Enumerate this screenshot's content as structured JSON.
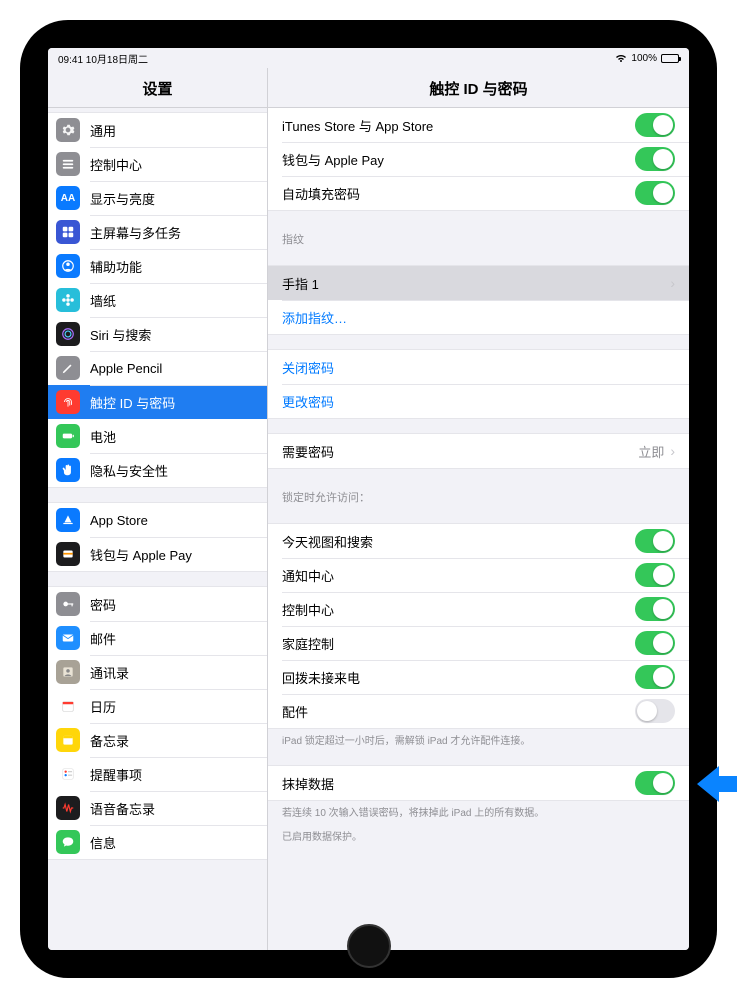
{
  "status": {
    "time_date": "09:41 10月18日周二",
    "battery_pct": "100%"
  },
  "sidebar": {
    "title": "设置",
    "groups": [
      {
        "items": [
          {
            "id": "general",
            "label": "通用",
            "icon_bg": "#8e8e93",
            "icon": "gear"
          },
          {
            "id": "control-center",
            "label": "控制中心",
            "icon_bg": "#8e8e93",
            "icon": "sliders"
          },
          {
            "id": "display-brightness",
            "label": "显示与亮度",
            "icon_bg": "#0a7aff",
            "icon": "aa"
          },
          {
            "id": "home-screen",
            "label": "主屏幕与多任务",
            "icon_bg": "#3956d4",
            "icon": "grid"
          },
          {
            "id": "accessibility",
            "label": "辅助功能",
            "icon_bg": "#0a7aff",
            "icon": "person"
          },
          {
            "id": "wallpaper",
            "label": "墙纸",
            "icon_bg": "#27beda",
            "icon": "flower"
          },
          {
            "id": "siri-search",
            "label": "Siri 与搜索",
            "icon_bg": "#1c1c1e",
            "icon": "siri"
          },
          {
            "id": "apple-pencil",
            "label": "Apple Pencil",
            "icon_bg": "#8e8e93",
            "icon": "pencil"
          },
          {
            "id": "touchid-passcode",
            "label": "触控 ID 与密码",
            "icon_bg": "#ff3b30",
            "icon": "fingerprint",
            "selected": true
          },
          {
            "id": "battery",
            "label": "电池",
            "icon_bg": "#34c759",
            "icon": "battery"
          },
          {
            "id": "privacy-security",
            "label": "隐私与安全性",
            "icon_bg": "#0a7aff",
            "icon": "hand"
          }
        ]
      },
      {
        "items": [
          {
            "id": "app-store",
            "label": "App Store",
            "icon_bg": "#0a7aff",
            "icon": "appstore"
          },
          {
            "id": "wallet-applepay",
            "label": "钱包与 Apple Pay",
            "icon_bg": "#1c1c1e",
            "icon": "wallet"
          }
        ]
      },
      {
        "items": [
          {
            "id": "passwords",
            "label": "密码",
            "icon_bg": "#8e8e93",
            "icon": "key"
          },
          {
            "id": "mail",
            "label": "邮件",
            "icon_bg": "#1f8fff",
            "icon": "mail"
          },
          {
            "id": "contacts",
            "label": "通讯录",
            "icon_bg": "#a8a296",
            "icon": "contacts"
          },
          {
            "id": "calendar",
            "label": "日历",
            "icon_bg": "#ffffff",
            "icon": "calendar"
          },
          {
            "id": "notes",
            "label": "备忘录",
            "icon_bg": "#ffd60a",
            "icon": "notes"
          },
          {
            "id": "reminders",
            "label": "提醒事项",
            "icon_bg": "#ffffff",
            "icon": "reminders"
          },
          {
            "id": "voice-memos",
            "label": "语音备忘录",
            "icon_bg": "#1c1c1e",
            "icon": "voice"
          },
          {
            "id": "messages",
            "label": "信息",
            "icon_bg": "#34c759",
            "icon": "message"
          }
        ]
      }
    ]
  },
  "detail": {
    "title": "触控 ID 与密码",
    "use_for": {
      "itunes_appstore": {
        "label": "iTunes Store 与 App Store",
        "on": true
      },
      "wallet_applepay": {
        "label": "钱包与 Apple Pay",
        "on": true
      },
      "password_autofill": {
        "label": "自动填充密码",
        "on": true
      }
    },
    "fingerprints": {
      "header": "指纹",
      "finger1": "手指 1",
      "add": "添加指纹…"
    },
    "passcode": {
      "turn_off": "关闭密码",
      "change": "更改密码"
    },
    "require": {
      "label": "需要密码",
      "value": "立即"
    },
    "allow_access": {
      "header": "锁定时允许访问：",
      "today_search": {
        "label": "今天视图和搜索",
        "on": true
      },
      "notification_center": {
        "label": "通知中心",
        "on": true
      },
      "control_center": {
        "label": "控制中心",
        "on": true
      },
      "home_control": {
        "label": "家庭控制",
        "on": true
      },
      "return_calls": {
        "label": "回拨未接来电",
        "on": true
      },
      "accessories": {
        "label": "配件",
        "on": false
      },
      "footer": "iPad 锁定超过一小时后，需解锁 iPad 才允许配件连接。"
    },
    "erase": {
      "label": "抹掉数据",
      "on": true,
      "footer1": "若连续 10 次输入错误密码，将抹掉此 iPad 上的所有数据。",
      "footer2": "已启用数据保护。"
    }
  }
}
